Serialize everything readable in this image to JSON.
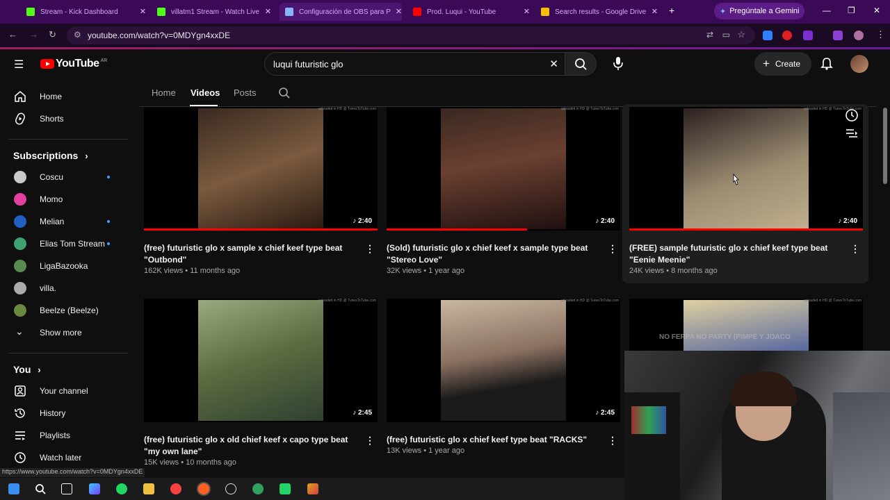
{
  "browser": {
    "tabs": [
      {
        "label": "Stream - Kick Dashboard",
        "color": "#53fc18"
      },
      {
        "label": "villatm1 Stream - Watch Live",
        "color": "#53fc18"
      },
      {
        "label": "Configuración de OBS para P",
        "color": "#8ab4f8"
      },
      {
        "label": "Prod. Luqui - YouTube",
        "color": "#ff0000"
      },
      {
        "label": "Search results - Google Drive",
        "color": "#fbbc04"
      }
    ],
    "gemini_label": "Pregúntale a Gemini",
    "url": "youtube.com/watch?v=0MDYgn4xxDE",
    "status_url": "https://www.youtube.com/watch?v=0MDYgn4xxDE"
  },
  "youtube": {
    "logo_text": "YouTube",
    "country_code": "AR",
    "search_value": "luqui futuristic glo",
    "create_label": "Create"
  },
  "sidebar": {
    "home": "Home",
    "shorts": "Shorts",
    "subscriptions_header": "Subscriptions",
    "subscriptions": [
      {
        "label": "Coscu",
        "dot": true,
        "color": "#c9c9c9"
      },
      {
        "label": "Momo",
        "dot": false,
        "color": "#e040a0"
      },
      {
        "label": "Melian",
        "dot": true,
        "color": "#2060c0"
      },
      {
        "label": "Elias Tom Stream",
        "dot": true,
        "color": "#3fa070"
      },
      {
        "label": "LigaBazooka",
        "dot": false,
        "color": "#5a8a50"
      },
      {
        "label": "villa.",
        "dot": false,
        "color": "#aaaaaa"
      },
      {
        "label": "Beelze (Beelze)",
        "dot": false,
        "color": "#6a8a40"
      }
    ],
    "show_more": "Show more",
    "you_header": "You",
    "you_items": [
      "Your channel",
      "History",
      "Playlists",
      "Watch later"
    ]
  },
  "channel_tabs": [
    "Home",
    "Videos",
    "Posts"
  ],
  "videos": [
    {
      "title": "(free) futuristic glo x sample x chief keef type beat \"Outbond\"",
      "meta": "162K views • 11 months ago",
      "duration": "2:40",
      "progress": 1.0,
      "thumb": "#6a4a3a"
    },
    {
      "title": "(Sold) futuristic glo x chief keef x sample type beat \"Stereo Love\"",
      "meta": "32K views • 1 year ago",
      "duration": "2:40",
      "progress": 0.6,
      "thumb": "#5a3a30"
    },
    {
      "title": "(FREE) sample futuristic glo x chief keef type beat \"Eenie Meenie\"",
      "meta": "24K views • 8 months ago",
      "duration": "2:40",
      "progress": 1.0,
      "thumb": "#8a7a60"
    },
    {
      "title": "(free) futuristic glo x old chief keef x capo type beat \"my own lane\"",
      "meta": "15K views • 10 months ago",
      "duration": "2:45",
      "progress": 0,
      "thumb": "#6a8a5a"
    },
    {
      "title": "(free) futuristic glo x chief keef type beat \"RACKS\"",
      "meta": "13K views • 1 year ago",
      "duration": "2:45",
      "progress": 0,
      "thumb": "#a09080"
    },
    {
      "title": "",
      "meta": "",
      "duration": "",
      "progress": 0,
      "thumb": "#5a6a9a"
    }
  ],
  "watermark": "uploaded in HD @ TunesToTube.com",
  "webcam_overlay": "NO FERPA NO PARTY (PIMPE Y JOACO"
}
